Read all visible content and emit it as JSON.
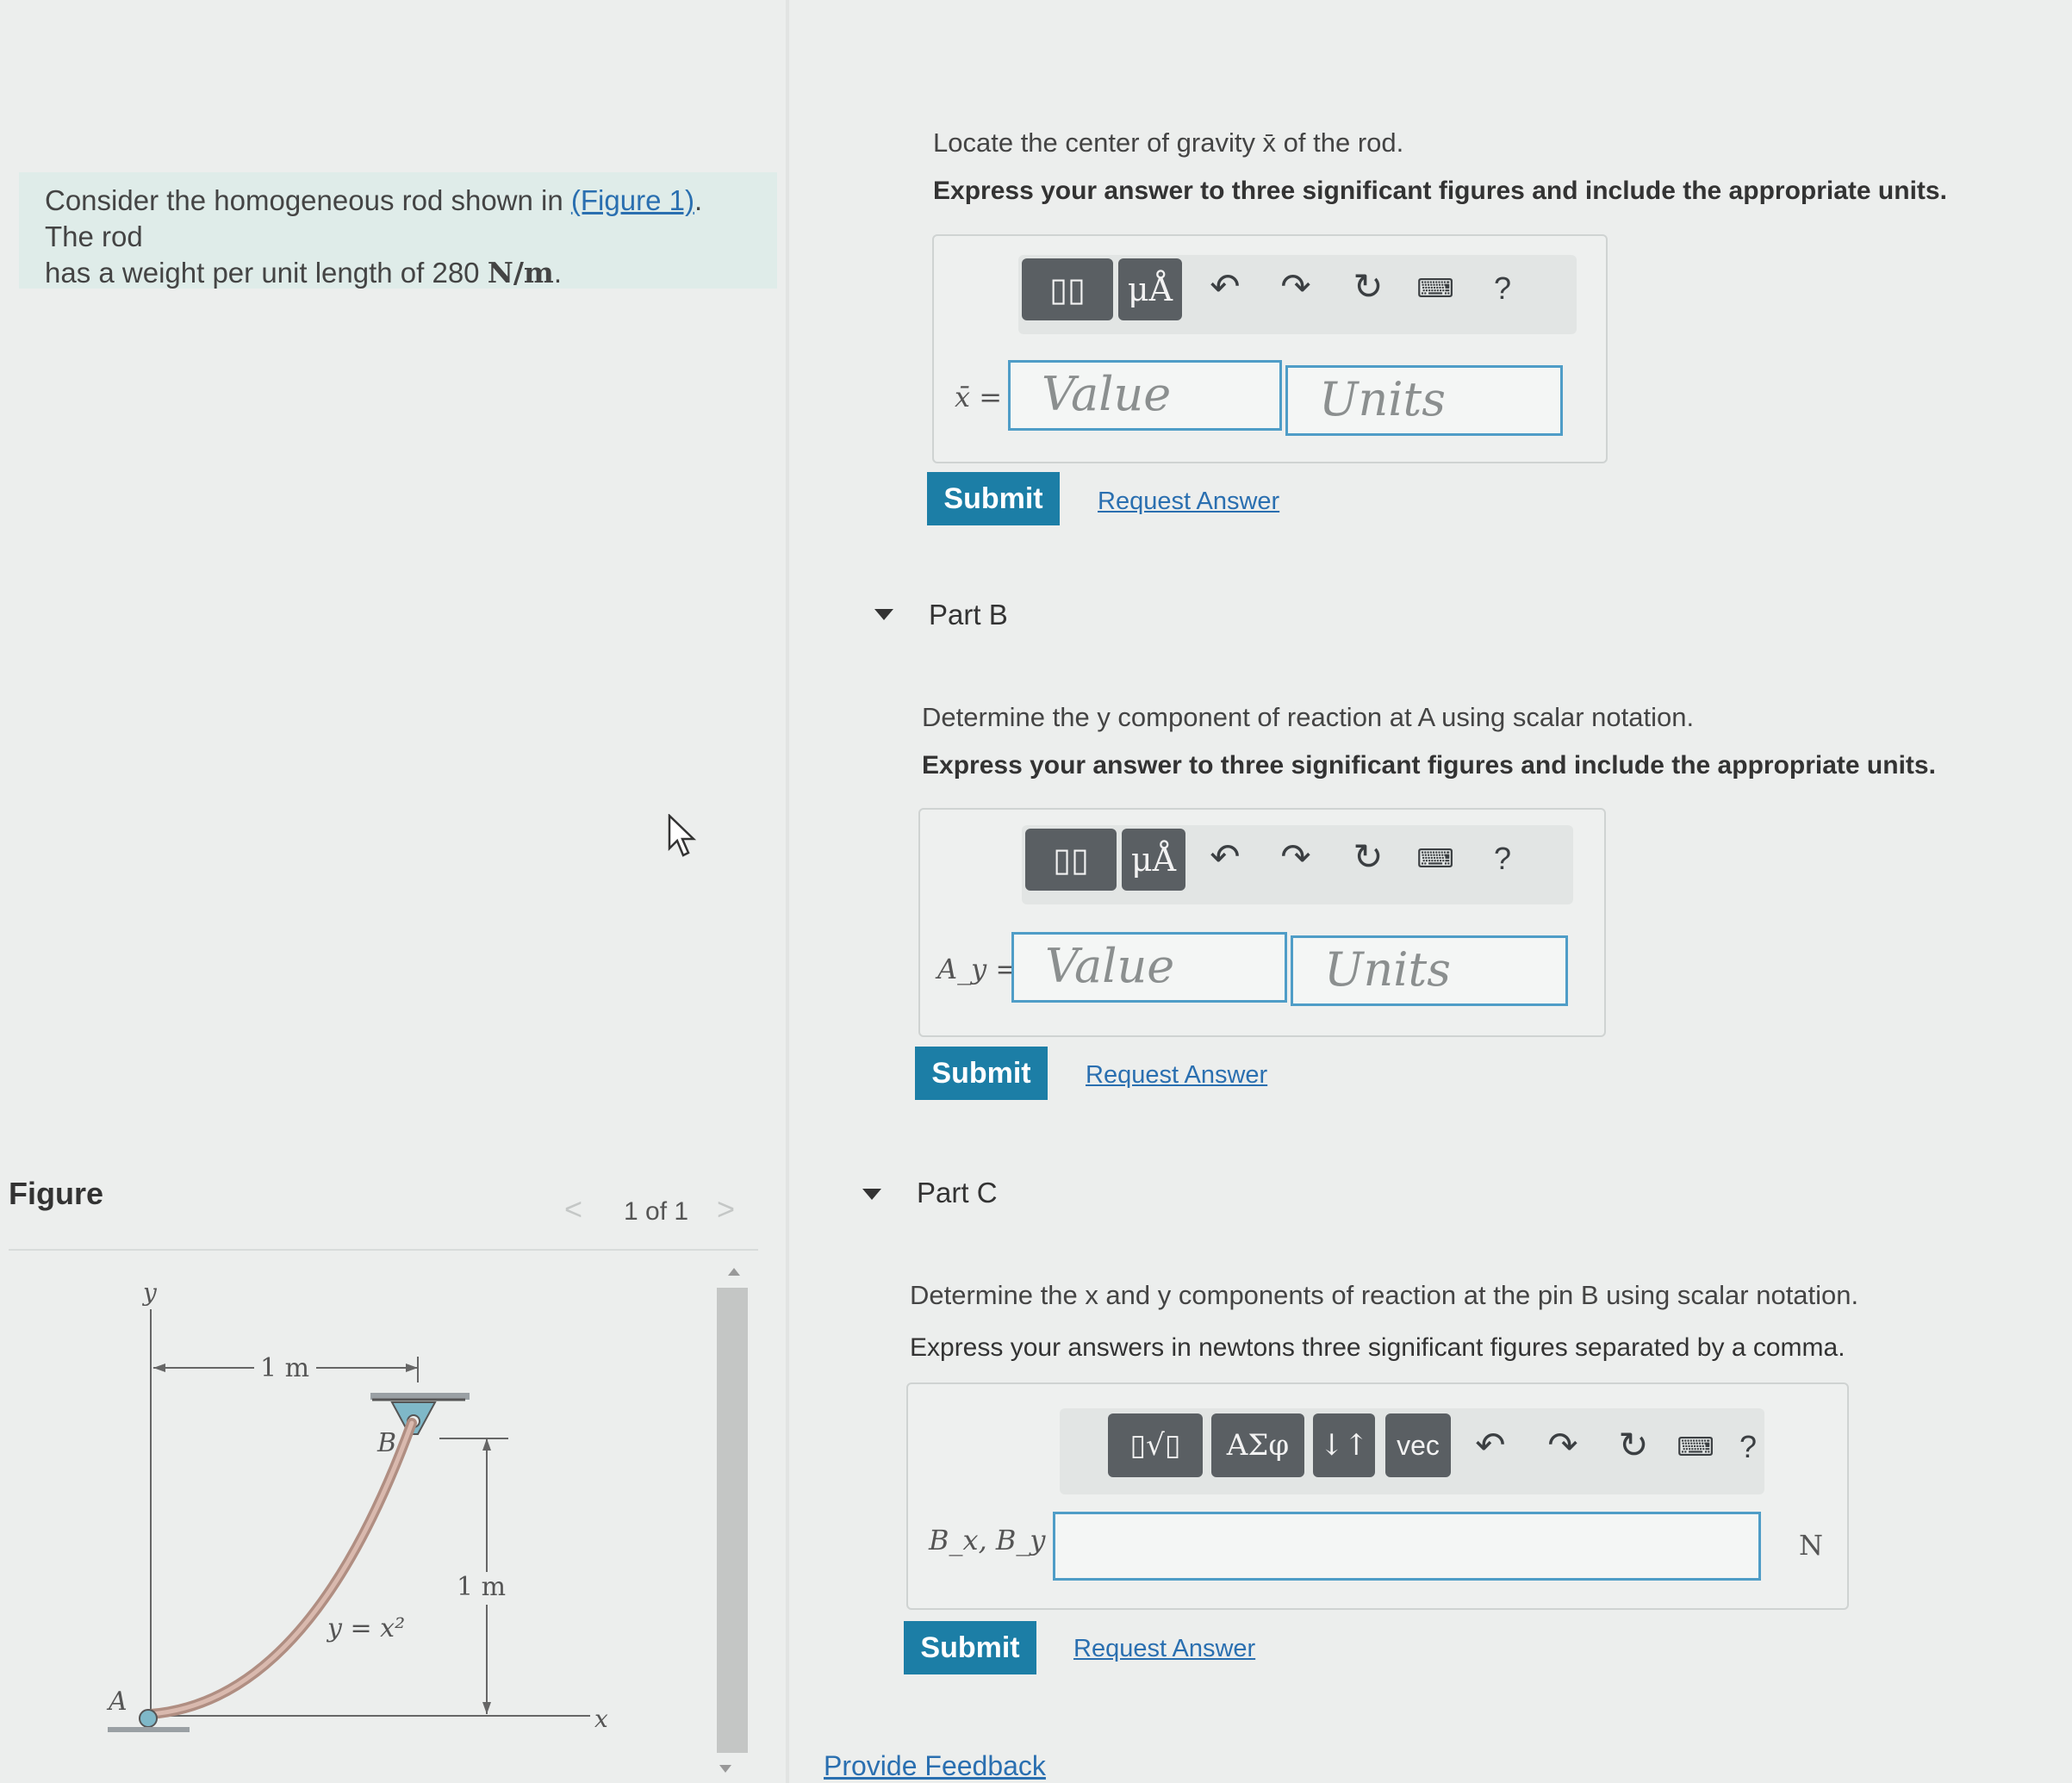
{
  "problem": {
    "text_before": "Consider the homogeneous rod shown in ",
    "figure_link": "(Figure 1)",
    "text_after_link": ". The rod",
    "line2": "has a weight per unit length of 280 ",
    "units": "N/m",
    "period": "."
  },
  "figure": {
    "heading": "Figure",
    "prev": "<",
    "counter": "1 of 1",
    "next": ">",
    "labels": {
      "y_axis": "y",
      "x_axis": "x",
      "top_dim": "1 m",
      "side_dim": "1 m",
      "point_b": "B",
      "point_a": "A",
      "curve": "y = x²"
    }
  },
  "partA": {
    "prompt": "Locate the center of gravity x̄ of the rod.",
    "instruction": "Express your answer to three significant figures and include the appropriate units.",
    "label": "x̄ =",
    "value_placeholder": "Value",
    "units_placeholder": "Units",
    "toolbar": {
      "templates": "▯▯",
      "units": "μÅ",
      "help": "?"
    },
    "submit": "Submit",
    "request": "Request Answer"
  },
  "partB": {
    "header": "Part B",
    "prompt": "Determine the y component of reaction at A using scalar notation.",
    "instruction": "Express your answer to three significant figures and include the appropriate units.",
    "label": "A_y =",
    "value_placeholder": "Value",
    "units_placeholder": "Units",
    "toolbar": {
      "templates": "▯▯",
      "units": "μÅ",
      "help": "?"
    },
    "submit": "Submit",
    "request": "Request Answer"
  },
  "partC": {
    "header": "Part C",
    "prompt": "Determine the x and y components of reaction at the pin B using scalar notation.",
    "instruction": "Express your answers in newtons three significant figures separated by a comma.",
    "label": "B_x, B_y =",
    "unit": "N",
    "toolbar": {
      "templates": "▯√▯",
      "greek": "AΣφ",
      "arrows": "↓↑",
      "vec": "vec",
      "help": "?"
    },
    "submit": "Submit",
    "request": "Request Answer"
  },
  "footer": {
    "feedback": "Provide Feedback"
  },
  "colors": {
    "accent": "#1c7ea6",
    "field_border": "#4f9dc7",
    "link": "#2a6fb0",
    "problem_bg": "#dfece9"
  }
}
